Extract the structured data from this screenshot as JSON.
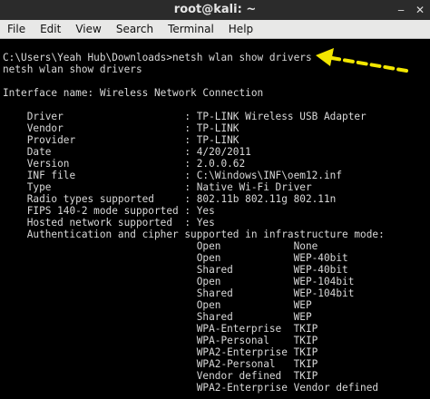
{
  "window": {
    "title": "root@kali: ~",
    "buttons": [
      "‒",
      "✕"
    ]
  },
  "menu": [
    "File",
    "Edit",
    "View",
    "Search",
    "Terminal",
    "Help"
  ],
  "terminal": {
    "lines": [
      "C:\\Users\\Yeah Hub\\Downloads>netsh wlan show drivers",
      "netsh wlan show drivers",
      "",
      "Interface name: Wireless Network Connection",
      "",
      "    Driver                    : TP-LINK Wireless USB Adapter",
      "    Vendor                    : TP-LINK",
      "    Provider                  : TP-LINK",
      "    Date                      : 4/20/2011",
      "    Version                   : 2.0.0.62",
      "    INF file                  : C:\\Windows\\INF\\oem12.inf",
      "    Type                      : Native Wi-Fi Driver",
      "    Radio types supported     : 802.11b 802.11g 802.11n",
      "    FIPS 140-2 mode supported : Yes",
      "    Hosted network supported  : Yes",
      "    Authentication and cipher supported in infrastructure mode:",
      "                                Open            None",
      "                                Open            WEP-40bit",
      "                                Shared          WEP-40bit",
      "                                Open            WEP-104bit",
      "                                Shared          WEP-104bit",
      "                                Open            WEP",
      "                                Shared          WEP",
      "                                WPA-Enterprise  TKIP",
      "                                WPA-Personal    TKIP",
      "                                WPA2-Enterprise TKIP",
      "                                WPA2-Personal   TKIP",
      "                                Vendor defined  TKIP",
      "                                WPA2-Enterprise Vendor defined"
    ]
  },
  "colors": {
    "terminal_bg": "#000000",
    "terminal_fg": "#d8d8d8",
    "arrow": "#f2e600"
  }
}
